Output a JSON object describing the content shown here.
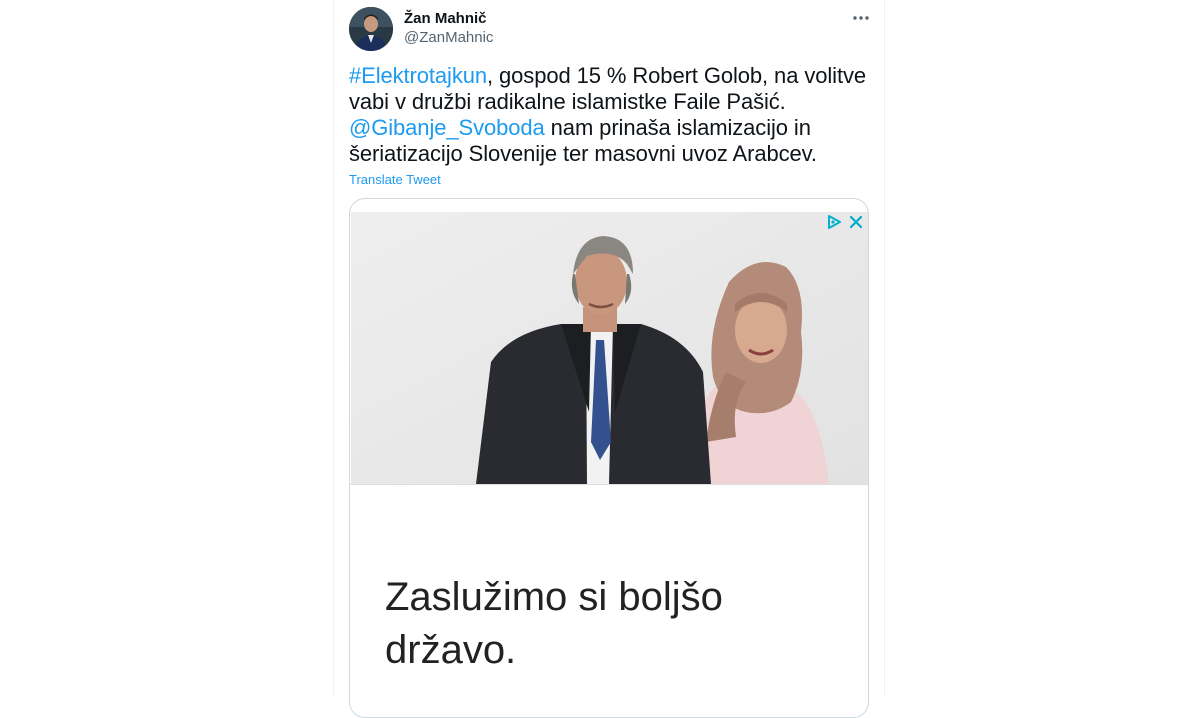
{
  "tweet": {
    "display_name": "Žan Mahnič",
    "handle": "@ZanMahnic",
    "more_icon": "more-horizontal-icon",
    "text": {
      "hashtag": "#Elektrotajkun",
      "part1": ", gospod 15 % Robert Golob, na volitve vabi v družbi radikalne islamistke Faile Pašić.",
      "mention": "@Gibanje_Svoboda",
      "part2": " nam prinaša islamizacijo in šeriatizacijo Slovenije ter masovni uvoz Arabcev."
    },
    "translate_label": "Translate Tweet",
    "link_color": "#1d9bf0"
  },
  "ad_card": {
    "adchoices_icon": "adchoices-icon",
    "close_icon": "close-icon",
    "headline": "Zaslužimo si boljšo državo."
  }
}
